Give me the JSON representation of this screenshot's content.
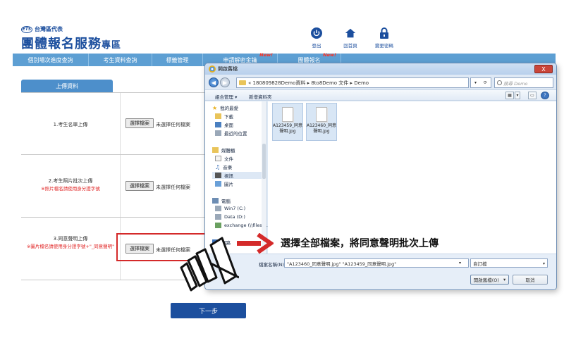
{
  "header": {
    "logo_badge": "ETS",
    "logo_sub": "台灣區代表",
    "logo_title_main": "團體報名服務",
    "logo_title_small": "專區",
    "icons": [
      {
        "label": "登出",
        "icon": "power-icon"
      },
      {
        "label": "回首頁",
        "icon": "home-icon"
      },
      {
        "label": "變更密碼",
        "icon": "lock-icon"
      }
    ]
  },
  "nav": {
    "items": [
      {
        "label": "個別場次進度查詢",
        "new": ""
      },
      {
        "label": "考生資料查詢",
        "new": ""
      },
      {
        "label": "標籤管理",
        "new": ""
      },
      {
        "label": "申請解密金鑰",
        "new": "New!"
      },
      {
        "label": "團體報名",
        "new": "New!"
      }
    ]
  },
  "tab": {
    "label": "上傳資料"
  },
  "form": {
    "rows": [
      {
        "label": "1.考生名單上傳",
        "note": "",
        "button": "選擇檔案",
        "status": "未選擇任何檔案"
      },
      {
        "label": "2.考生照片批次上傳",
        "note": "※照片檔名請使用身分證字號",
        "button": "選擇檔案",
        "status": "未選擇任何檔案"
      },
      {
        "label": "3.同意聲明上傳",
        "note": "※圖片檔名請使用身分證字號+\"_同意聲明\"",
        "button": "選擇檔案",
        "status": "未選擇任何檔案"
      }
    ]
  },
  "next_button": {
    "label": "下一步"
  },
  "dialog": {
    "title": "開啟舊檔",
    "close_label": "X",
    "address": "« 180809828Demo資料 ▸ 8to8Demo 文件 ▸ Demo",
    "search_placeholder": "搜尋 Demo",
    "toolbar": {
      "organize": "組合管理 ▾",
      "new_folder": "新增資料夾"
    },
    "sidebar": {
      "favorites": "我的最愛",
      "favorites_items": [
        "下載",
        "桌面",
        "最近的位置"
      ],
      "libraries": "媒體櫃",
      "libraries_items": [
        "文件",
        "音樂",
        "視訊",
        "圖片"
      ],
      "computer": "電腦",
      "computer_items": [
        "Win7 (C:)",
        "Data (D:)",
        "exchange (\\\\filesrv..."
      ],
      "network": "網路"
    },
    "files": [
      {
        "name": "A123459_同意聲明.jpg"
      },
      {
        "name": "A123460_同意聲明.jpg"
      }
    ],
    "filename_label": "檔案名稱(N):",
    "filename_value": "\"A123460_同意聲明.jpg\" \"A123459_同意聲明.jpg\"",
    "filetype_value": "自訂檔",
    "open_button": "開啟舊檔(O)",
    "cancel_button": "取消"
  },
  "annotation": {
    "text": "選擇全部檔案，將同意聲明批次上傳"
  },
  "colors": {
    "brand_blue": "#1c4f9e",
    "nav_blue": "#5d9fd3",
    "highlight_red": "#d42a2a"
  }
}
